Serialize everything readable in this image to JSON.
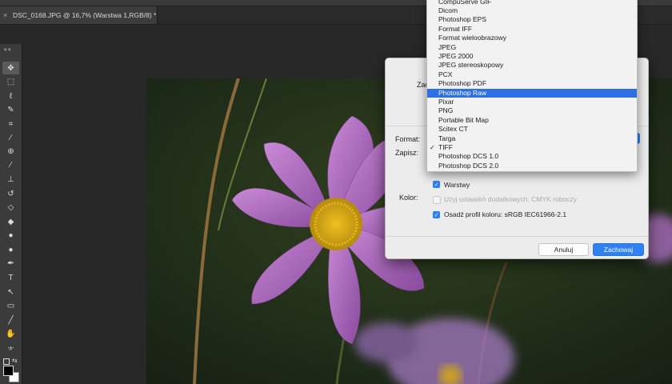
{
  "document_tab": {
    "close_icon": "×",
    "title": "DSC_0168.JPG @ 16,7% (Warstwa 1,RGB/8) *"
  },
  "toolbar": {
    "grip": "◂◂",
    "tools": [
      {
        "name": "move-tool-icon",
        "glyph": "✥"
      },
      {
        "name": "marquee-tool-icon",
        "glyph": "⬚"
      },
      {
        "name": "lasso-tool-icon",
        "glyph": "ℓ"
      },
      {
        "name": "quick-select-tool-icon",
        "glyph": "✎"
      },
      {
        "name": "crop-tool-icon",
        "glyph": "⌗"
      },
      {
        "name": "eyedropper-tool-icon",
        "glyph": "⁄"
      },
      {
        "name": "healing-brush-tool-icon",
        "glyph": "⊕"
      },
      {
        "name": "brush-tool-icon",
        "glyph": "⁄"
      },
      {
        "name": "clone-stamp-tool-icon",
        "glyph": "⊥"
      },
      {
        "name": "history-brush-tool-icon",
        "glyph": "↺"
      },
      {
        "name": "eraser-tool-icon",
        "glyph": "◇"
      },
      {
        "name": "paint-bucket-tool-icon",
        "glyph": "◆"
      },
      {
        "name": "blur-tool-icon",
        "glyph": "●"
      },
      {
        "name": "dodge-tool-icon",
        "glyph": "●"
      },
      {
        "name": "pen-tool-icon",
        "glyph": "✒"
      },
      {
        "name": "type-tool-icon",
        "glyph": "T"
      },
      {
        "name": "path-select-tool-icon",
        "glyph": "↖"
      },
      {
        "name": "rectangle-tool-icon",
        "glyph": "▭"
      },
      {
        "name": "line-tool-icon",
        "glyph": "╱"
      },
      {
        "name": "hand-tool-icon",
        "glyph": "✋"
      },
      {
        "name": "zoom-tool-icon",
        "glyph": "⌕"
      },
      {
        "name": "more-tools-icon",
        "glyph": "···"
      }
    ]
  },
  "dialog": {
    "label_zach": "Zac",
    "format_label": "Format:",
    "zapisz_label": "Zapisz:",
    "kolor_label": "Kolor:",
    "stepper_icon": "⌄",
    "options": [
      {
        "label": "Warstwy",
        "checked": true,
        "disabled": false
      },
      {
        "label": "Użyj ustawień dodatkowych:  CMYK roboczy",
        "checked": false,
        "disabled": true
      },
      {
        "label": "Osadź profil koloru:  sRGB IEC61966-2.1",
        "checked": true,
        "disabled": false
      }
    ],
    "cancel_label": "Anuluj",
    "save_label": "Zachowaj"
  },
  "format_menu": {
    "selected_index": 10,
    "checked_index": 16,
    "check_glyph": "✓",
    "items": [
      "CompuServe GIF",
      "Dicom",
      "Photoshop EPS",
      "Format IFF",
      "Format wieloobrazowy",
      "JPEG",
      "JPEG 2000",
      "JPEG stereoskopowy",
      "PCX",
      "Photoshop PDF",
      "Photoshop Raw",
      "Pixar",
      "PNG",
      "Portable Bit Map",
      "Scitex CT",
      "Targa",
      "TIFF",
      "Photoshop DCS 1.0",
      "Photoshop DCS 2.0"
    ]
  },
  "colors": {
    "accent": "#2f80f0",
    "menu_highlight": "#2f6fe4"
  }
}
